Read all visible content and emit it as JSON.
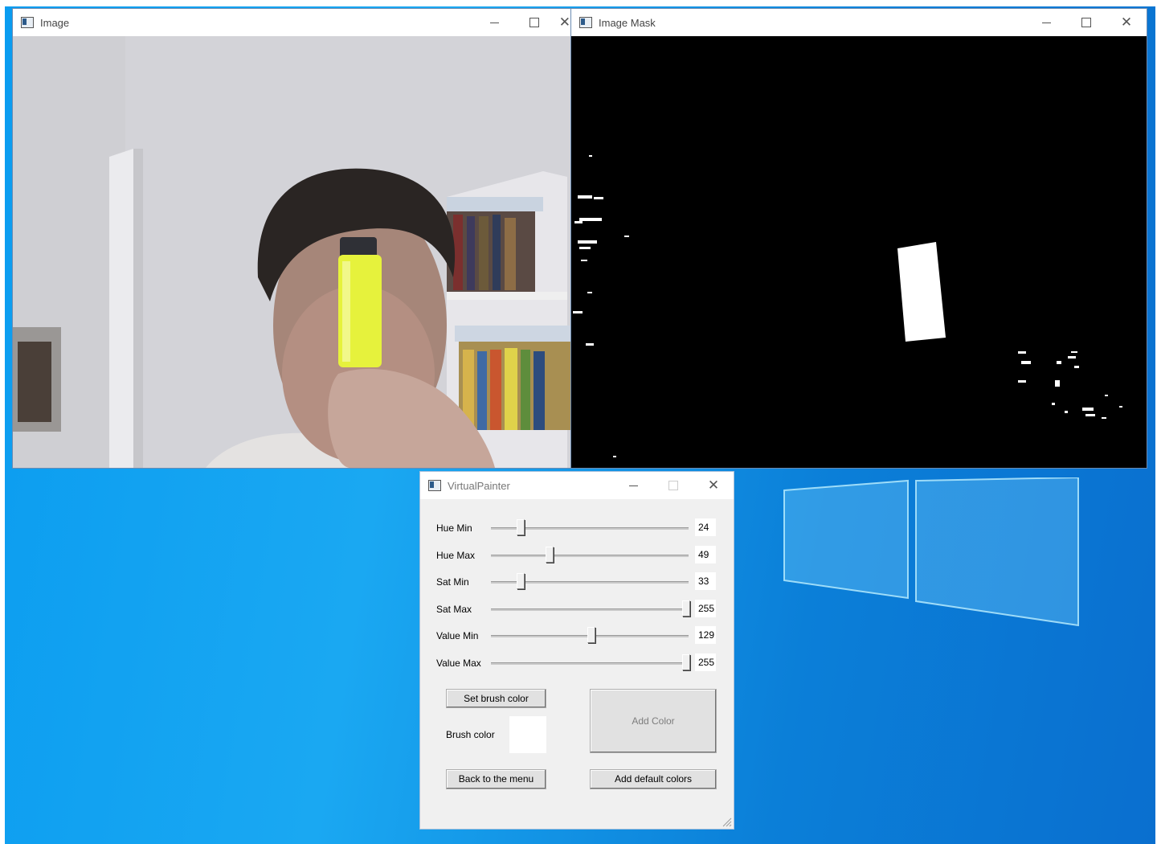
{
  "windows": {
    "image": {
      "title": "Image"
    },
    "mask": {
      "title": "Image Mask"
    },
    "painter": {
      "title": "VirtualPainter",
      "sliders": [
        {
          "label": "Hue Min",
          "value": "24",
          "fraction": 0.14
        },
        {
          "label": "Hue Max",
          "value": "49",
          "fraction": 0.29
        },
        {
          "label": "Sat Min",
          "value": "33",
          "fraction": 0.14
        },
        {
          "label": "Sat Max",
          "value": "255",
          "fraction": 1.0
        },
        {
          "label": "Value Min",
          "value": "129",
          "fraction": 0.51
        },
        {
          "label": "Value Max",
          "value": "255",
          "fraction": 1.0
        }
      ],
      "set_brush_label": "Set brush color",
      "brush_color_label": "Brush color",
      "brush_color": "#ffffff",
      "add_color_label": "Add Color",
      "back_label": "Back to the menu",
      "add_default_label": "Add default colors"
    }
  },
  "colors": {
    "desktop": "#0a9cf0",
    "highlighter": "#e6f23c",
    "mask_white": "#ffffff"
  }
}
